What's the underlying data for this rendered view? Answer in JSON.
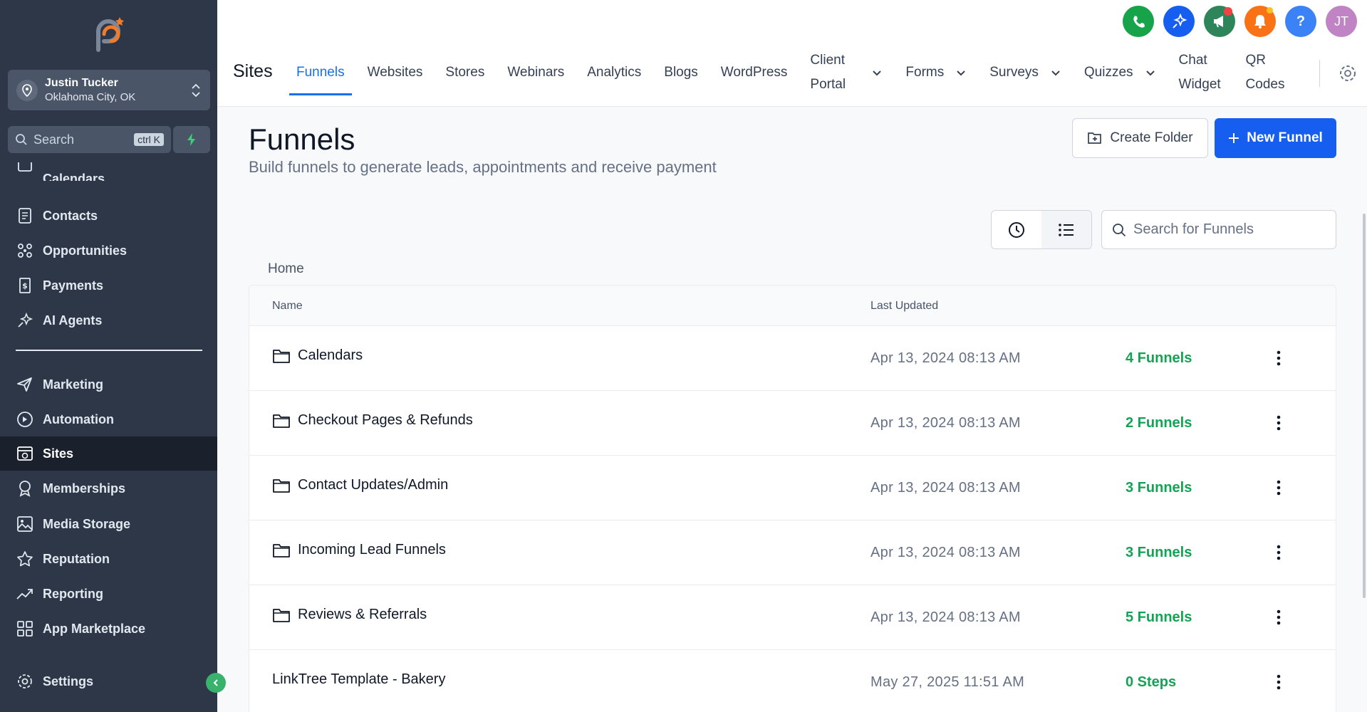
{
  "account": {
    "name": "Justin Tucker",
    "location": "Oklahoma City, OK"
  },
  "search": {
    "label": "Search",
    "shortcut": "ctrl K"
  },
  "sidebar": {
    "items": [
      {
        "label": "Calendars",
        "icon": "calendar-icon"
      },
      {
        "label": "Contacts",
        "icon": "contacts-icon"
      },
      {
        "label": "Opportunities",
        "icon": "opportunities-icon"
      },
      {
        "label": "Payments",
        "icon": "payments-icon"
      },
      {
        "label": "AI Agents",
        "icon": "ai-agents-icon"
      },
      {
        "label": "Marketing",
        "icon": "marketing-icon"
      },
      {
        "label": "Automation",
        "icon": "automation-icon"
      },
      {
        "label": "Sites",
        "icon": "sites-icon"
      },
      {
        "label": "Memberships",
        "icon": "memberships-icon"
      },
      {
        "label": "Media Storage",
        "icon": "media-storage-icon"
      },
      {
        "label": "Reputation",
        "icon": "reputation-icon"
      },
      {
        "label": "Reporting",
        "icon": "reporting-icon"
      },
      {
        "label": "App Marketplace",
        "icon": "app-marketplace-icon"
      },
      {
        "label": "Settings",
        "icon": "settings-icon"
      }
    ]
  },
  "topbar": {
    "section_title": "Sites",
    "avatar_initials": "JT",
    "help_symbol": "?",
    "tabs": [
      {
        "label": "Funnels"
      },
      {
        "label": "Websites"
      },
      {
        "label": "Stores"
      },
      {
        "label": "Webinars"
      },
      {
        "label": "Analytics"
      },
      {
        "label": "Blogs"
      },
      {
        "label": "WordPress"
      },
      {
        "label": "Client Portal"
      },
      {
        "label": "Forms"
      },
      {
        "label": "Surveys"
      },
      {
        "label": "Quizzes"
      },
      {
        "label": "Chat Widget"
      },
      {
        "label": "QR Codes"
      }
    ]
  },
  "page": {
    "title": "Funnels",
    "subtitle": "Build funnels to generate leads, appointments and receive payment",
    "create_folder_label": "Create Folder",
    "new_funnel_label": "New Funnel",
    "search_placeholder": "Search for Funnels",
    "breadcrumb": "Home"
  },
  "table": {
    "columns": {
      "name": "Name",
      "last_updated": "Last Updated"
    },
    "rows": [
      {
        "name": "Calendars",
        "updated": "Apr 13, 2024 08:13 AM",
        "count": "4 Funnels",
        "type": "folder"
      },
      {
        "name": "Checkout Pages & Refunds",
        "updated": "Apr 13, 2024 08:13 AM",
        "count": "2 Funnels",
        "type": "folder"
      },
      {
        "name": "Contact Updates/Admin",
        "updated": "Apr 13, 2024 08:13 AM",
        "count": "3 Funnels",
        "type": "folder"
      },
      {
        "name": "Incoming Lead Funnels",
        "updated": "Apr 13, 2024 08:13 AM",
        "count": "3 Funnels",
        "type": "folder"
      },
      {
        "name": "Reviews & Referrals",
        "updated": "Apr 13, 2024 08:13 AM",
        "count": "5 Funnels",
        "type": "folder"
      },
      {
        "name": "LinkTree Template - Bakery",
        "updated": "May 27, 2025 11:51 AM",
        "count": "0 Steps",
        "type": "funnel"
      }
    ]
  },
  "colors": {
    "sidebar": "#2d3748",
    "accent": "#155eef",
    "count_green": "#12a454"
  }
}
